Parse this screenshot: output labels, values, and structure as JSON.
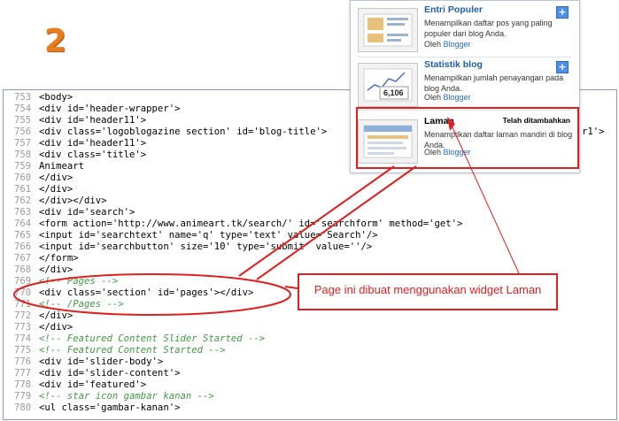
{
  "step_number": "2",
  "code_lines": [
    {
      "no": "753",
      "text": "<body>",
      "kind": "tag"
    },
    {
      "no": "754",
      "text": "<div id='header-wrapper'>",
      "kind": "tag"
    },
    {
      "no": "755",
      "text": "<div id='header11'>",
      "kind": "tag"
    },
    {
      "no": "756",
      "text": "<div class='logoblogazine section' id='blog-title'>",
      "kind": "tag",
      "tail": "r1'>"
    },
    {
      "no": "757",
      "text": "<div id='header11'>",
      "kind": "tag"
    },
    {
      "no": "758",
      "text": "<div class='title'>",
      "kind": "tag"
    },
    {
      "no": "759",
      "text": "Animeart",
      "kind": "plain"
    },
    {
      "no": "760",
      "text": "</div>",
      "kind": "tag"
    },
    {
      "no": "761",
      "text": "</div>",
      "kind": "tag"
    },
    {
      "no": "762",
      "text": "</div></div>",
      "kind": "tag"
    },
    {
      "no": "763",
      "text": "<div id='search'>",
      "kind": "tag"
    },
    {
      "no": "764",
      "text": "<form action='http://www.animeart.tk/search/' id='searchform' method='get'>",
      "kind": "tag"
    },
    {
      "no": "765",
      "text": "<input id='searchtext' name='q' type='text' value='Search'/>",
      "kind": "tag"
    },
    {
      "no": "766",
      "text": "<input id='searchbutton' size='10' type='submit' value=''/>",
      "kind": "tag"
    },
    {
      "no": "767",
      "text": "</form>",
      "kind": "tag"
    },
    {
      "no": "768",
      "text": "</div>",
      "kind": "tag"
    },
    {
      "no": "769",
      "text": "<!-- Pages -->",
      "kind": "comment"
    },
    {
      "no": "770",
      "text": "<div class='section' id='pages'></div>",
      "kind": "tag"
    },
    {
      "no": "771",
      "text": "<!-- /Pages -->",
      "kind": "comment"
    },
    {
      "no": "772",
      "text": "</div>",
      "kind": "tag"
    },
    {
      "no": "773",
      "text": "</div>",
      "kind": "tag"
    },
    {
      "no": "774",
      "text": "<!-- Featured Content Slider Started -->",
      "kind": "comment"
    },
    {
      "no": "775",
      "text": "<!-- Featured Content Started -->",
      "kind": "comment"
    },
    {
      "no": "776",
      "text": "<div id='slider-body'>",
      "kind": "tag"
    },
    {
      "no": "777",
      "text": "<div id='slider-content'>",
      "kind": "tag"
    },
    {
      "no": "778",
      "text": "<div id='featured'>",
      "kind": "tag"
    },
    {
      "no": "779",
      "text": "<!-- star icon gambar kanan -->",
      "kind": "comment"
    },
    {
      "no": "780",
      "text": "<ul class='gambar-kanan'>",
      "kind": "tag"
    }
  ],
  "widgets": [
    {
      "title": "Entri Populer",
      "description": "Menampilkan daftar pos yang paling populer dari blog Anda.",
      "by_prefix": "Oleh",
      "author": "Blogger",
      "action": "+",
      "thumb_icon": "popular-posts-icon"
    },
    {
      "title": "Statistik blog",
      "description": "Menampilkan jumlah penayangan pada blog Anda.",
      "by_prefix": "Oleh",
      "author": "Blogger",
      "action": "+",
      "thumb_value": "6,106",
      "thumb_icon": "stats-chart-icon"
    },
    {
      "title": "Laman",
      "description": "Menampilkan daftar laman mandiri di blog Anda.",
      "by_prefix": "Oleh",
      "author": "Blogger",
      "status": "Telah ditambahkan",
      "thumb_icon": "pages-icon"
    }
  ],
  "callout": "Page ini dibuat menggunakan widget Laman",
  "colors": {
    "accent_red": "#e01f1f",
    "step_orange": "#e87d1e",
    "link_blue": "#1f5ea8",
    "comment_green": "#3f9a3f"
  }
}
